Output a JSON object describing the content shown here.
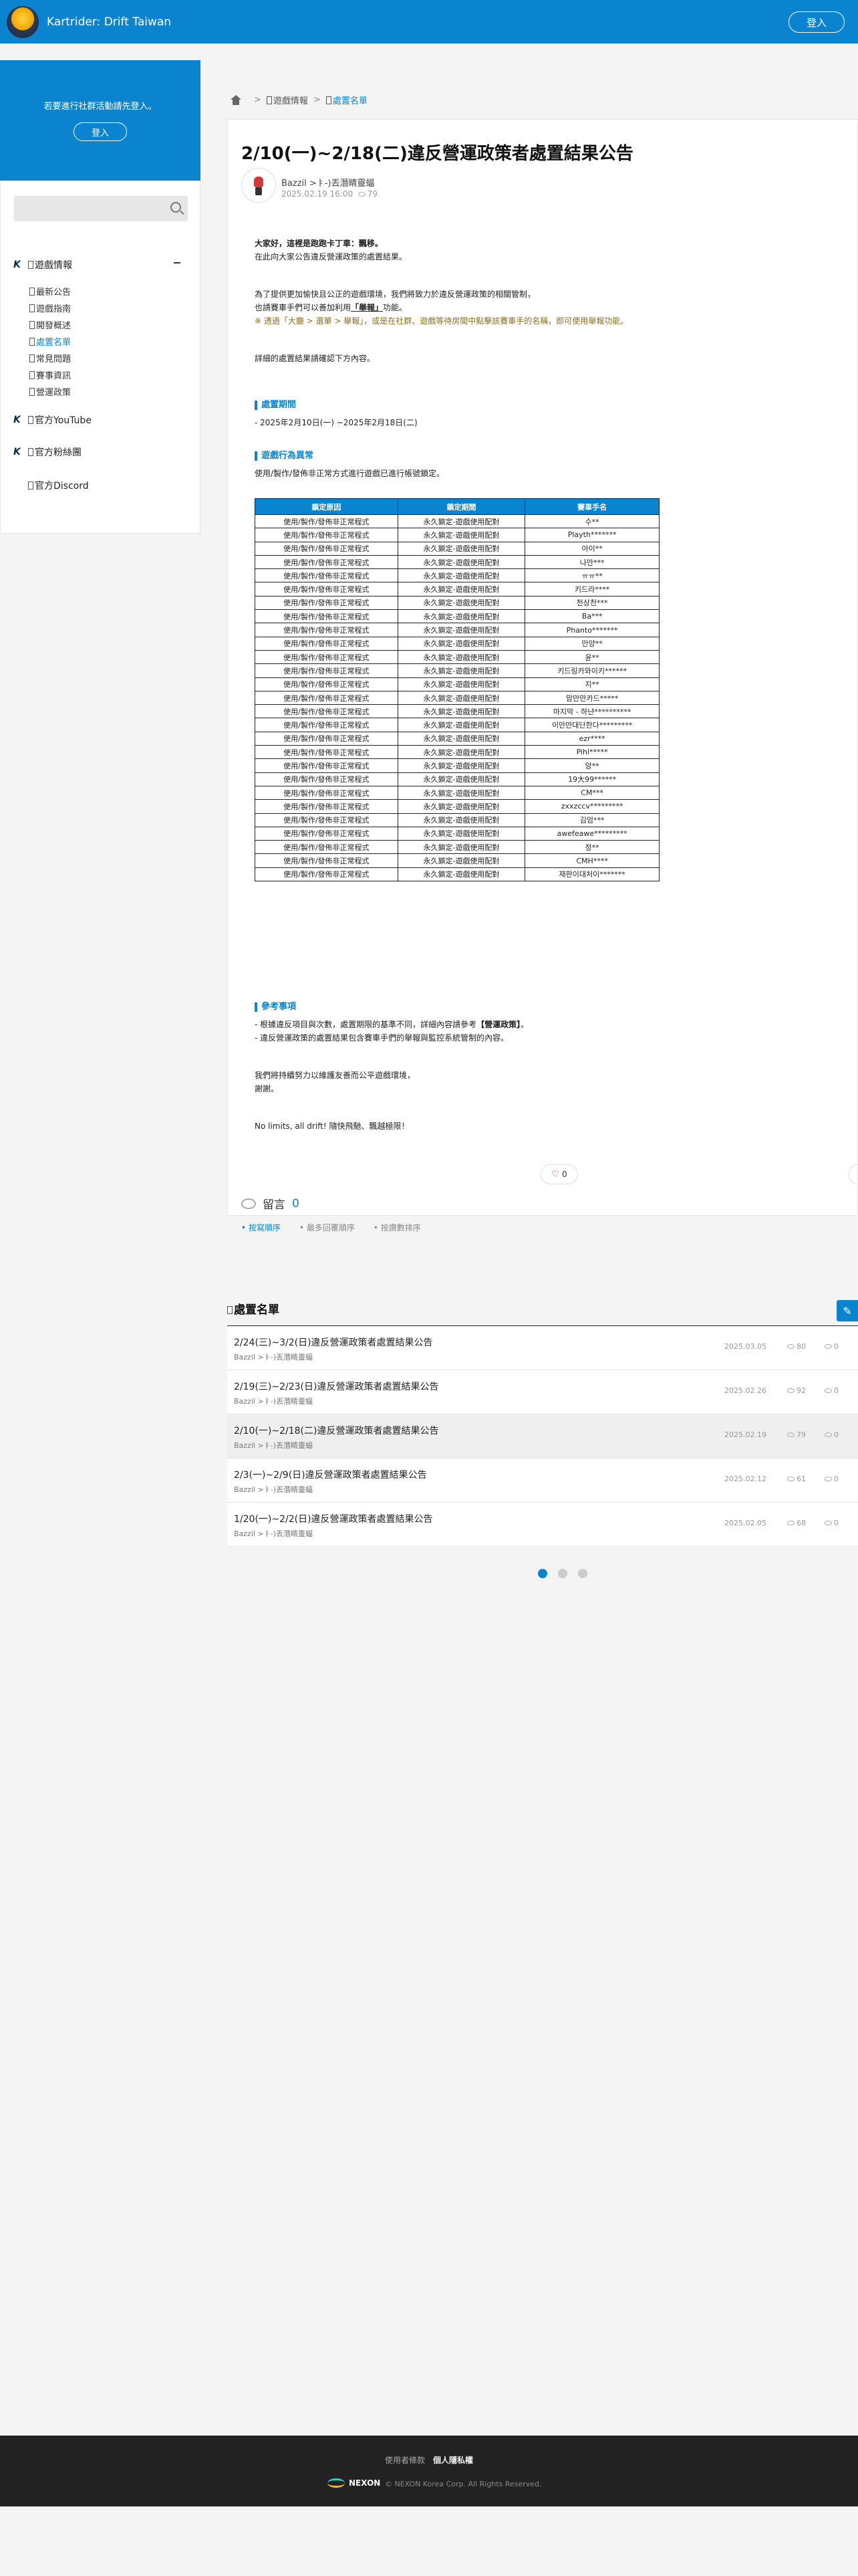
{
  "header": {
    "site_title": "Kartrider: Drift Taiwan",
    "login": "登入"
  },
  "sidebar": {
    "login_msg": "若要進行社群活動請先登入。",
    "login_btn": "登入",
    "groups": [
      "遊戲情報",
      "官方YouTube",
      "官方粉絲團",
      "官方Discord"
    ],
    "sub_items": [
      "最新公告",
      "遊戲指南",
      "開發概述",
      "處置名單",
      "常見問題",
      "賽事資訊",
      "營運政策"
    ],
    "active_sub": "處置名單"
  },
  "breadcrumb": [
    "遊戲情報",
    "處置名單"
  ],
  "article": {
    "title": "2/10(一)~2/18(二)違反營運政策者處置結果公告",
    "author": "Bazzil >ㅑ-)丟潛睛靈蝠",
    "date": "2025.02.19 16:00",
    "views": "79",
    "greeting": "大家好，這裡是跑跑卡丁車：飄移。",
    "intro": "在此向大家公告違反營運政策的處置結果。",
    "p2_line1": "為了提供更加愉快且公正的遊戲環境，我們將致力於違反營運政策的相關管制，",
    "p2_line2_a": "也請賽車手們可以善加利用",
    "p2_line2_b": "「舉報」",
    "p2_line2_c": "功能。",
    "p2_line3": "※ 透過「大廳 > 選單 > 舉報」，或是在社群、遊戲等待房間中點擊該賽車手的名稱，即可使用舉報功能。",
    "p3": "詳細的處置結果請確認下方內容。",
    "sec_period": "處置期間",
    "period": "- 2025年2月10日(一) ~2025年2月18日(二)",
    "sec_type": "遊戲行為異常",
    "type_desc": "使用/製作/發佈非正常方式進行遊戲已進行帳號鎖定。",
    "table_headers": [
      "鎖定原因",
      "鎖定期間",
      "賽車手名"
    ],
    "reason": "使用/製作/發佈非正常程式",
    "period_a": "永久鎖定-遊戲使用配對",
    "period_b": "永久鎖定-遊戲使用配對",
    "names": [
      "수**",
      "Playth*******",
      "아이**",
      "나만***",
      "ㅠㅠ**",
      "키드라****",
      "천상천***",
      "Ba***",
      "Phanto*******",
      "만양**",
      "윤**",
      "키드링카와이키******",
      "지**",
      "맘만만카드*****",
      "마지막 - 하냔**********",
      "이만만대단한다*********",
      "ezr****",
      "Pihl*****",
      "앙**",
      "19大99******",
      "CM***",
      "zxxzccv*********",
      "김엄***",
      "awefeawe*********",
      "정**",
      "CMH****",
      "재판이대처이*******"
    ],
    "period_variant_rows": [
      2,
      6,
      8,
      10,
      13,
      14,
      15,
      17,
      19,
      21
    ],
    "sec_ref": "參考事項",
    "ref1_a": "- 根據違反項目與次數，處置期限的基準不同，詳細內容請參考",
    "ref1_b": "【營運政策】",
    "ref1_c": "。",
    "ref2": "- 違反營運政策的處置結果包含賽車手們的舉報與監控系統管制的內容。",
    "closing1": "我們將持續努力以維護友善而公平遊戲環境，",
    "closing2": "謝謝。",
    "closing3": "No limits, all drift! 隨快飛馳、飄越極限！",
    "likes": "0",
    "comments_label": "留言",
    "comments_count": "0",
    "sorts": [
      "按寫順序",
      "最多回覆順序",
      "按讚數排序"
    ]
  },
  "list": {
    "title": "處置名單",
    "items": [
      {
        "title": "2/24(三)~3/2(日)違反營運政策者處置結果公告",
        "author": "Bazzil >ㅑ-)丟潛睛靈蝠",
        "date": "2025.03.05",
        "views": "80",
        "comments": "0"
      },
      {
        "title": "2/19(三)~2/23(日)違反營運政策者處置結果公告",
        "author": "Bazzil >ㅑ-)丟潛睛靈蝠",
        "date": "2025.02.26",
        "views": "92",
        "comments": "0"
      },
      {
        "title": "2/10(一)~2/18(二)違反營運政策者處置結果公告",
        "author": "Bazzil >ㅑ-)丟潛睛靈蝠",
        "date": "2025.02.19",
        "views": "79",
        "comments": "0"
      },
      {
        "title": "2/3(一)~2/9(日)違反營運政策者處置結果公告",
        "author": "Bazzil >ㅑ-)丟潛睛靈蝠",
        "date": "2025.02.12",
        "views": "61",
        "comments": "0"
      },
      {
        "title": "1/20(一)~2/2(日)違反營運政策者處置結果公告",
        "author": "Bazzil >ㅑ-)丟潛睛靈蝠",
        "date": "2025.02.05",
        "views": "68",
        "comments": "0"
      }
    ],
    "selected_index": 2,
    "pages": 3
  },
  "footer": {
    "terms": "使用者條款",
    "privacy": "個人隱私權",
    "brand": "NEXON",
    "copyright": "© NEXON Korea Corp. All Rights Reserved."
  },
  "colors": {
    "brand": "#0a84ce",
    "footer": "#222222"
  }
}
